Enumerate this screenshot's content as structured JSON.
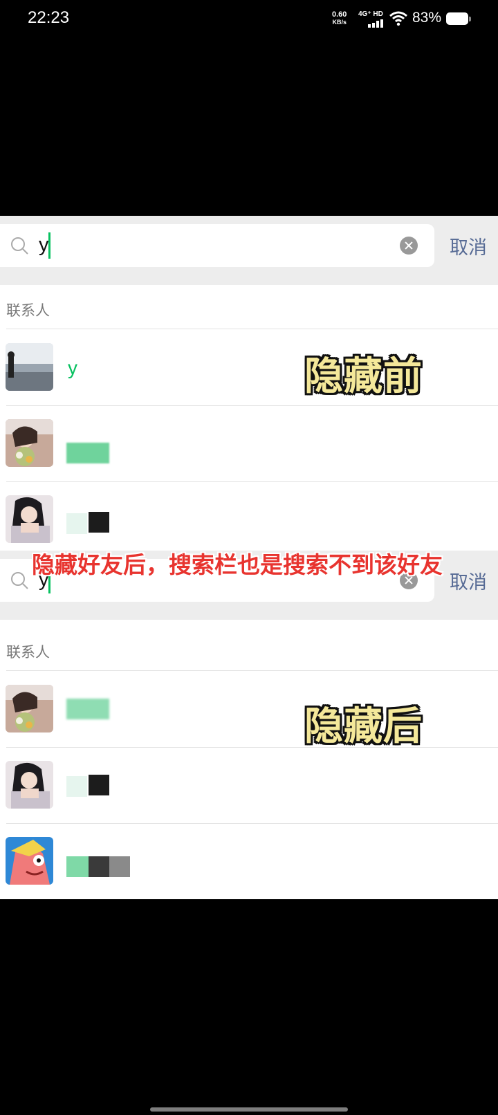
{
  "status_bar": {
    "time": "22:23",
    "net_speed_value": "0.60",
    "net_speed_unit": "KB/s",
    "signal_label": "4G⁺ HD",
    "battery": "83%"
  },
  "search_top": {
    "query": "y",
    "cancel_label": "取消"
  },
  "search_bottom": {
    "query": "y",
    "cancel_label": "取消"
  },
  "section_label_top": "联系人",
  "section_label_bottom": "联系人",
  "contacts_before": [
    {
      "name": "y",
      "avatar": "landscape-photo"
    },
    {
      "name": "",
      "avatar": "portrait-photo-flowers"
    },
    {
      "name": "",
      "avatar": "portrait-photo-girl"
    }
  ],
  "contacts_after": [
    {
      "name": "",
      "avatar": "portrait-photo-flowers"
    },
    {
      "name": "",
      "avatar": "portrait-photo-girl"
    },
    {
      "name": "",
      "avatar": "cartoon-patrick-star"
    }
  ],
  "captions": {
    "before": "隐藏前",
    "after": "隐藏后",
    "middle": "隐藏好友后，搜索栏也是搜索不到该好友"
  },
  "colors": {
    "accent_green": "#07c160",
    "link_blue": "#576b95",
    "caption_red": "#e8342f",
    "caption_yellow": "#f4e89a"
  }
}
